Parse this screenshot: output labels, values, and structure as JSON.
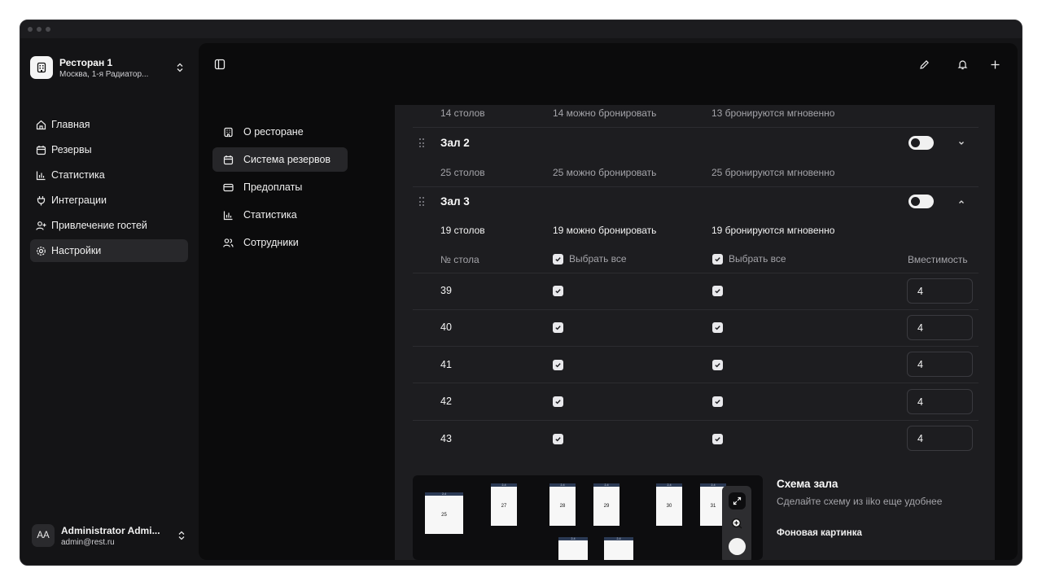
{
  "window": {
    "controls": [
      "close",
      "minimize",
      "maximize"
    ]
  },
  "restaurant": {
    "name": "Ресторан 1",
    "address": "Москва, 1-я Радиатор..."
  },
  "nav": [
    {
      "label": "Главная",
      "icon": "home-icon",
      "active": false
    },
    {
      "label": "Резервы",
      "icon": "calendar-icon",
      "active": false
    },
    {
      "label": "Статистика",
      "icon": "bar-chart-icon",
      "active": false
    },
    {
      "label": "Интеграции",
      "icon": "plug-icon",
      "active": false
    },
    {
      "label": "Привлечение гостей",
      "icon": "user-plus-icon",
      "active": false
    },
    {
      "label": "Настройки",
      "icon": "gear-icon",
      "active": true
    }
  ],
  "user": {
    "initials": "AA",
    "name": "Administrator Admi...",
    "email": "admin@rest.ru"
  },
  "subnav": [
    {
      "label": "О ресторане",
      "icon": "building-icon",
      "active": false
    },
    {
      "label": "Система резервов",
      "icon": "calendar-icon",
      "active": true
    },
    {
      "label": "Предоплаты",
      "icon": "credit-card-icon",
      "active": false
    },
    {
      "label": "Статистика",
      "icon": "bar-chart-icon",
      "active": false
    },
    {
      "label": "Сотрудники",
      "icon": "users-icon",
      "active": false
    }
  ],
  "halls": {
    "hall1": {
      "tables": "14 столов",
      "bookable": "14 можно бронировать",
      "instant": "13 бронируются мгновенно"
    },
    "hall2": {
      "title": "Зал 2",
      "enabled": true,
      "tables": "25 столов",
      "bookable": "25 можно бронировать",
      "instant": "25 бронируются мгновенно"
    },
    "hall3": {
      "title": "Зал 3",
      "enabled": true,
      "tables": "19 столов",
      "bookable": "19 можно бронировать",
      "instant": "19 бронируются мгновенно"
    }
  },
  "table_header": {
    "num": "№ стола",
    "select_all_1": "Выбрать все",
    "select_all_2": "Выбрать все",
    "capacity": "Вместимость"
  },
  "rows": [
    {
      "num": "39",
      "capacity": "4",
      "bookable": true,
      "instant": true
    },
    {
      "num": "40",
      "capacity": "4",
      "bookable": true,
      "instant": true
    },
    {
      "num": "41",
      "capacity": "4",
      "bookable": true,
      "instant": true
    },
    {
      "num": "42",
      "capacity": "4",
      "bookable": true,
      "instant": true
    },
    {
      "num": "43",
      "capacity": "4",
      "bookable": true,
      "instant": true
    }
  ],
  "scheme": {
    "title": "Схема зала",
    "subtitle": "Сделайте схему из iiko еще удобнее",
    "background_label": "Фоновая картинка",
    "tables": [
      {
        "label": "25",
        "cap": "2-4"
      },
      {
        "label": "27",
        "cap": "2-4"
      },
      {
        "label": "28",
        "cap": "2-4"
      },
      {
        "label": "29",
        "cap": "2-4"
      },
      {
        "label": "30",
        "cap": "2-4"
      },
      {
        "label": "31",
        "cap": "2-4"
      },
      {
        "label": "",
        "cap": "2-4"
      },
      {
        "label": "",
        "cap": "2-4"
      }
    ]
  }
}
